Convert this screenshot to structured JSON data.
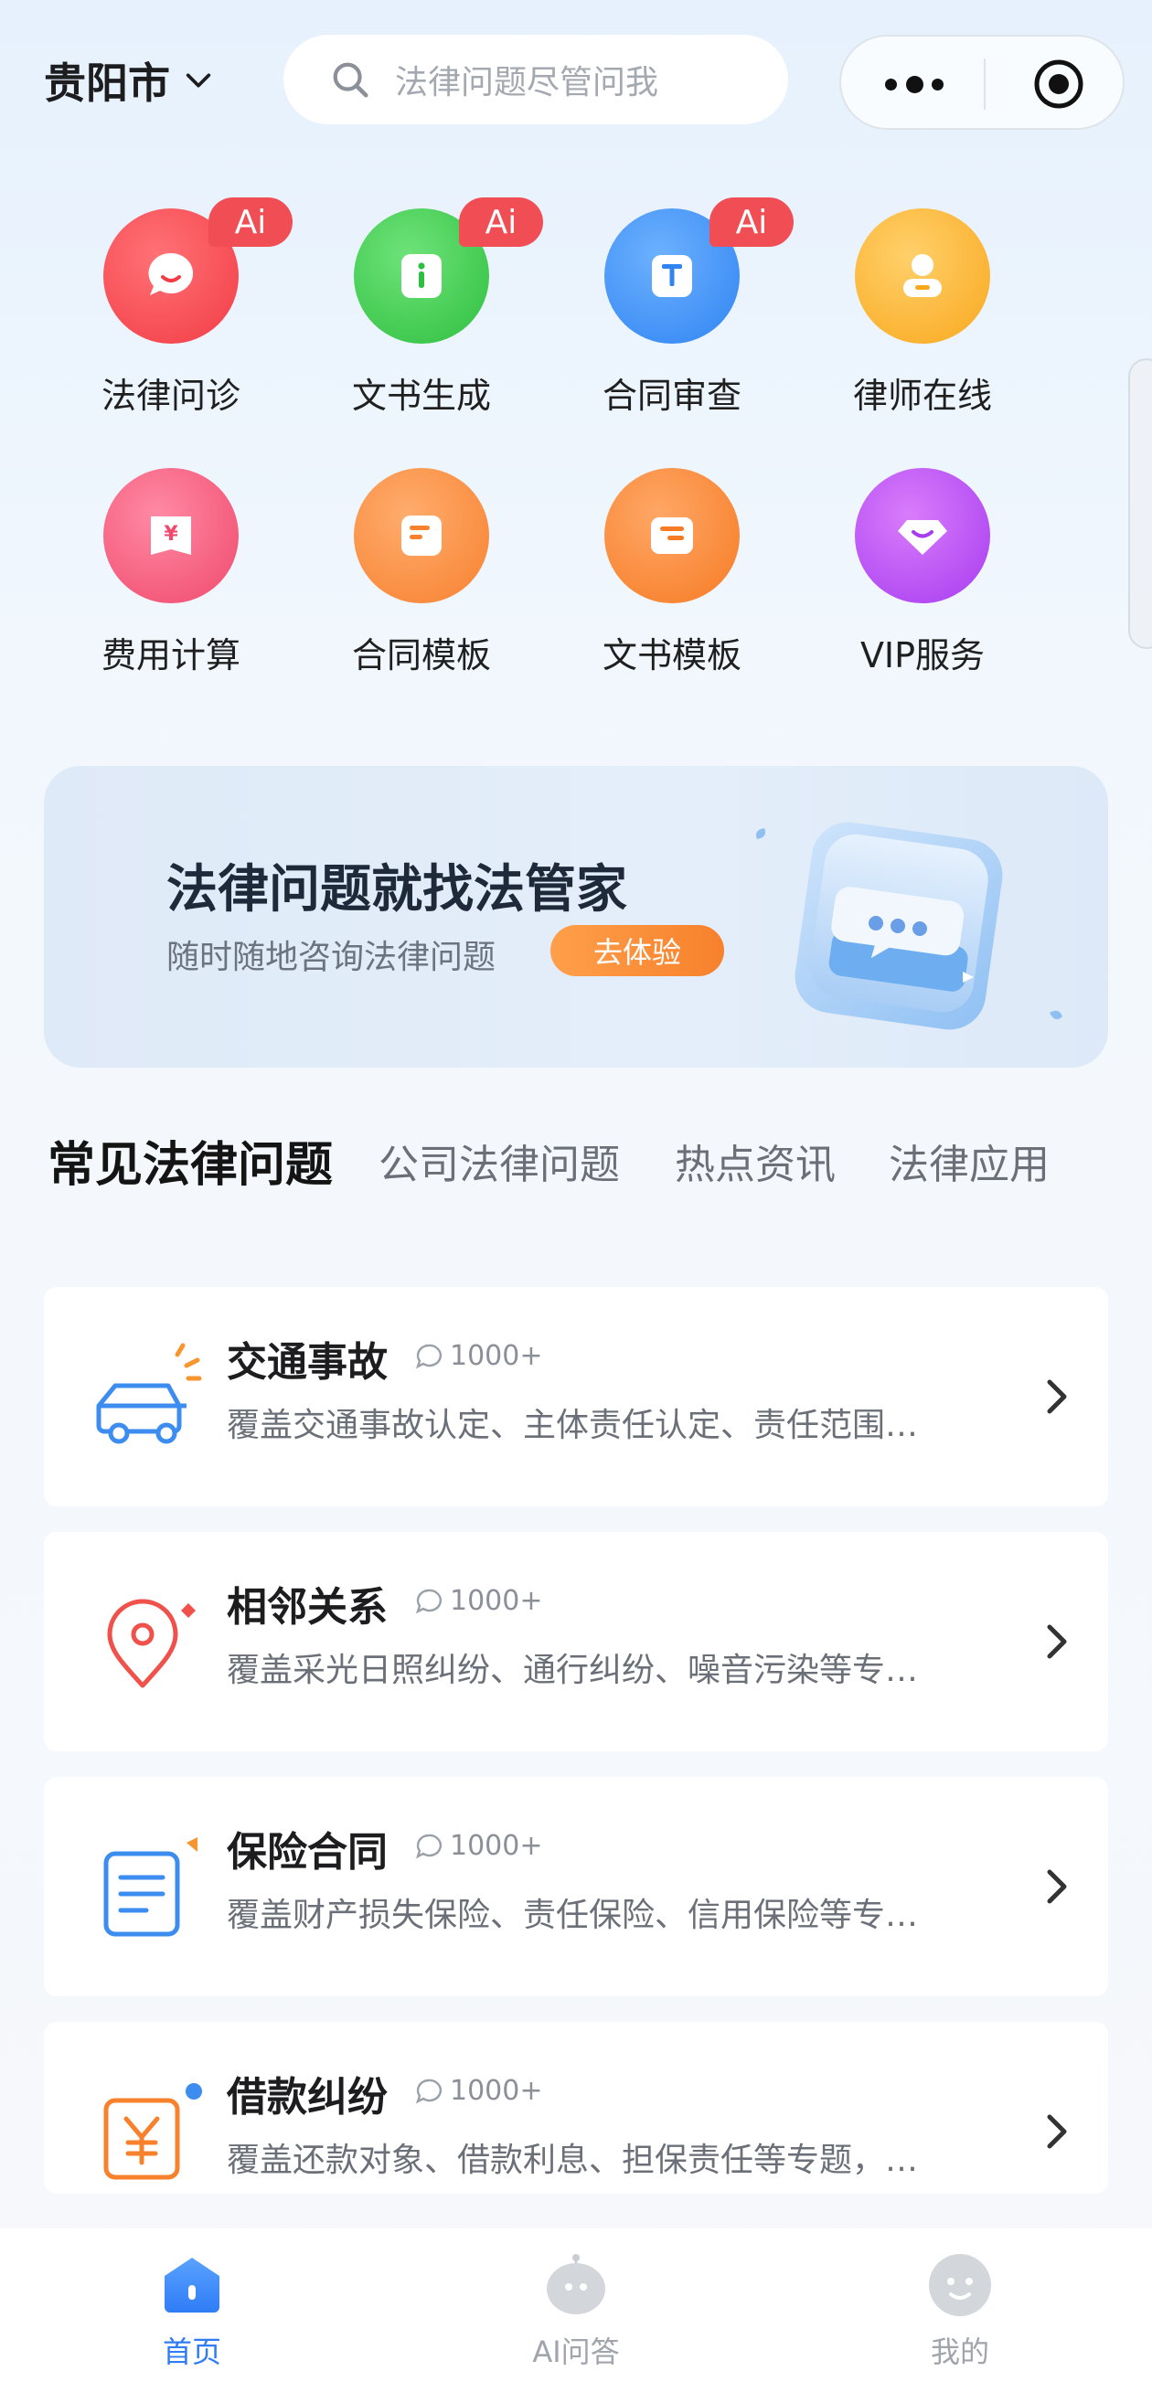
{
  "header": {
    "city": "贵阳市",
    "search_placeholder": "法律问题尽管问我"
  },
  "quick_grid": [
    {
      "label": "法律问诊",
      "badge": "Ai",
      "icon": "chat-bubble-icon",
      "color": "#f4474e"
    },
    {
      "label": "文书生成",
      "badge": "Ai",
      "icon": "info-document-icon",
      "color": "#3ecc4d"
    },
    {
      "label": "合同审查",
      "badge": "Ai",
      "icon": "contract-review-icon",
      "color": "#3d93f7"
    },
    {
      "label": "律师在线",
      "badge": "",
      "icon": "lawyer-icon",
      "color": "#fbb529"
    },
    {
      "label": "费用计算",
      "badge": "",
      "icon": "fee-calc-icon",
      "color": "#f45478"
    },
    {
      "label": "合同模板",
      "badge": "",
      "icon": "contract-template-icon",
      "color": "#fa8a3c"
    },
    {
      "label": "文书模板",
      "badge": "",
      "icon": "document-template-icon",
      "color": "#fb8530"
    },
    {
      "label": "VIP服务",
      "badge": "",
      "icon": "diamond-icon",
      "color": "#c04df3"
    }
  ],
  "banner": {
    "title": "法律问题就找法管家",
    "subtitle": "随时随地咨询法律问题",
    "button": "去体验"
  },
  "tabs": [
    "常见法律问题",
    "公司法律问题",
    "热点资讯",
    "法律应用"
  ],
  "topics": [
    {
      "title": "交通事故",
      "count": "1000+",
      "desc": "覆盖交通事故认定、主体责任认定、责任范围…",
      "icon": "car-icon"
    },
    {
      "title": "相邻关系",
      "count": "1000+",
      "desc": "覆盖采光日照纠纷、通行纠纷、噪音污染等专…",
      "icon": "location-pin-icon"
    },
    {
      "title": "保险合同",
      "count": "1000+",
      "desc": "覆盖财产损失保险、责任保险、信用保险等专…",
      "icon": "document-icon"
    },
    {
      "title": "借款纠纷",
      "count": "1000+",
      "desc": "覆盖还款对象、借款利息、担保责任等专题，…",
      "icon": "yuan-icon"
    }
  ],
  "tabbar": [
    {
      "label": "首页",
      "icon": "home-icon",
      "active": true
    },
    {
      "label": "AI问答",
      "icon": "robot-icon",
      "active": false
    },
    {
      "label": "我的",
      "icon": "profile-icon",
      "active": false
    }
  ],
  "colors": {
    "accent": "#2f7cf6",
    "badge": "#f04e54",
    "cta": "#f7812c"
  }
}
